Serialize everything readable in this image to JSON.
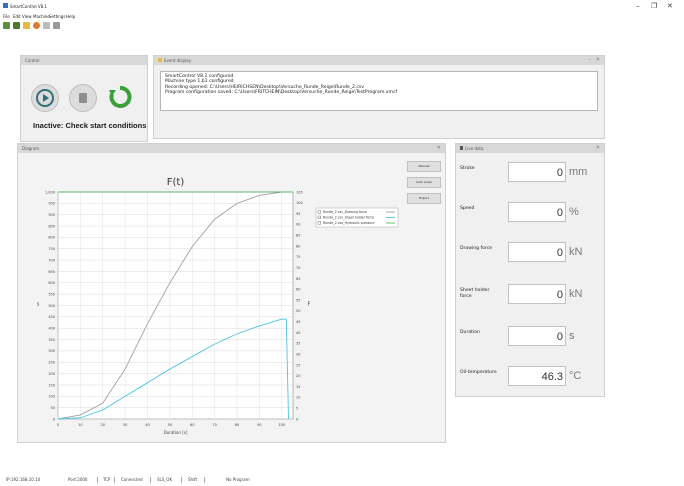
{
  "window": {
    "title": "SmartControl V8.1",
    "colors": {
      "accent": "#2e6fc4",
      "frame": "#d8d8d8"
    }
  },
  "menu": [
    "File",
    "Edit",
    "View",
    "Machine",
    "Settings",
    "Help"
  ],
  "toolbar_icons": [
    "new-icon",
    "open-icon",
    "folder-icon",
    "add-icon",
    "tools-icon",
    "print-icon"
  ],
  "control": {
    "title": "Control",
    "status_text": "Inactive: Check start conditions",
    "buttons": [
      "start",
      "stop",
      "reset"
    ]
  },
  "event_display": {
    "title": "Event display",
    "lines": [
      "SmartControl V8.1 configured",
      "Machine type 1.b1 configured",
      "Recording opened: C:\\Users\\HEIRICHSEN\\Desktop\\Versuche_Runde_Reige\\Runde_2.csv",
      "Program configuration saved: C:\\Users\\FRITCHEIN\\Desktop\\Versuche_Runde_Reige\\TestProgram.xmcf"
    ]
  },
  "diagram": {
    "title": "Diagram",
    "side_buttons": [
      "Manual",
      "Auto scale",
      "Export"
    ]
  },
  "chart_data": {
    "type": "line",
    "title": "F(t)",
    "xlabel": "Duration [s]",
    "ylabel": "s",
    "y2label": "F",
    "x_ticks": [
      "0",
      "10",
      "20",
      "30",
      "40",
      "50",
      "60",
      "70",
      "80",
      "90",
      "100"
    ],
    "y_ticks": [
      "0",
      "50",
      "100",
      "150",
      "200",
      "250",
      "300",
      "350",
      "400",
      "450",
      "500",
      "550",
      "600",
      "650",
      "700",
      "750",
      "800",
      "850",
      "900",
      "950",
      "1,000"
    ],
    "y2_ticks": [
      "0",
      "5",
      "10",
      "15",
      "20",
      "25",
      "30",
      "35",
      "40",
      "45",
      "50",
      "55",
      "60",
      "65",
      "70",
      "75",
      "80",
      "85",
      "90",
      "95",
      "100",
      "105"
    ],
    "xlim": [
      0,
      105
    ],
    "ylim": [
      0,
      1000
    ],
    "grid": true,
    "legend_position": "top-right",
    "series": [
      {
        "name": "Runde_2.csv_Drawing force",
        "color": "#a0a0a0",
        "x": [
          0,
          10,
          20,
          30,
          40,
          50,
          60,
          70,
          80,
          90,
          100,
          102
        ],
        "y": [
          0,
          18,
          70,
          220,
          420,
          600,
          760,
          880,
          950,
          985,
          1000,
          1000
        ]
      },
      {
        "name": "Runde_2.csv_Sheet holder force",
        "color": "#4fc3e8",
        "x": [
          0,
          10,
          20,
          30,
          40,
          50,
          60,
          70,
          80,
          90,
          100,
          102,
          103
        ],
        "y": [
          0,
          5,
          40,
          100,
          160,
          220,
          275,
          330,
          375,
          410,
          440,
          440,
          0
        ]
      },
      {
        "name": "Runde_2.csv_Hydraulic pressure",
        "color": "#5cb85c",
        "x": [
          0,
          100,
          105
        ],
        "y": [
          1000,
          1000,
          1000
        ]
      }
    ]
  },
  "live_data": {
    "title": "Live data",
    "rows": [
      {
        "label": "Stroke",
        "value": "0",
        "unit": "mm"
      },
      {
        "label": "Speed",
        "value": "0",
        "unit": "%"
      },
      {
        "label": "Drawing force",
        "value": "0",
        "unit": "kN"
      },
      {
        "label": "Sheet holder force",
        "value": "0",
        "unit": "kN"
      },
      {
        "label": "Duration",
        "value": "0",
        "unit": "s"
      },
      {
        "label": "Oil-temperature",
        "value": "46.3",
        "unit": "°C"
      }
    ]
  },
  "statusbar": [
    "IP:192.168.10.10",
    "Port:2000",
    "TCP",
    "Connected",
    "SLS_OK",
    "Shift",
    "No Program"
  ]
}
